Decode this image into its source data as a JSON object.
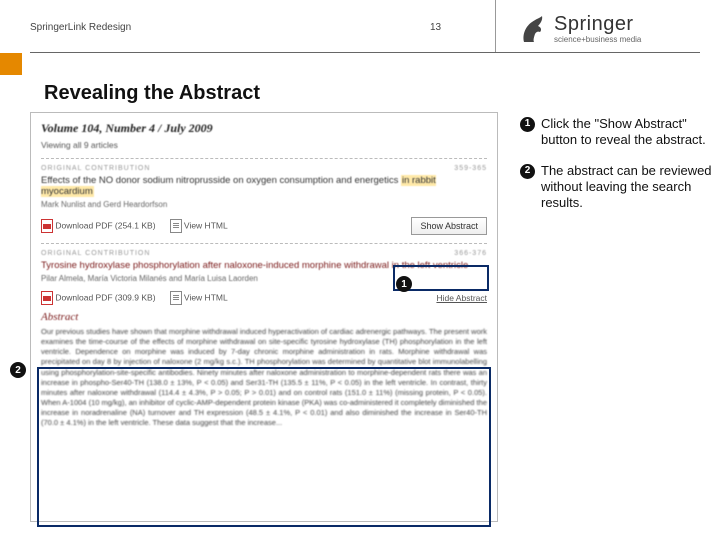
{
  "header": {
    "left": "SpringerLink Redesign",
    "page_number": "13",
    "logo_name": "Springer",
    "logo_tagline": "science+business media"
  },
  "title": "Revealing the Abstract",
  "notes": [
    {
      "num": "1",
      "text": "Click the \"Show Abstract\" button to reveal the abstract."
    },
    {
      "num": "2",
      "text": "The abstract can be reviewed without leaving the search results."
    }
  ],
  "markers": {
    "m1": "1",
    "m2": "2"
  },
  "figure": {
    "volume_line": "Volume 104, Number 4 / July 2009",
    "viewing": "Viewing all 9 articles",
    "article1": {
      "category": "ORIGINAL CONTRIBUTION",
      "pages": "359-365",
      "title_pre": "Effects of the NO donor sodium nitroprusside on oxygen consumption and energetics ",
      "title_hl": "in rabbit myocardium",
      "authors": "Mark Nunlist and Gerd Heardorfson",
      "download": "Download PDF (254.1 KB)",
      "view_html": "View HTML",
      "show_abstract": "Show Abstract"
    },
    "article2": {
      "category": "ORIGINAL CONTRIBUTION",
      "pages": "366-376",
      "title_pre": "Tyrosine hydroxylase phosphorylation after naloxone-induced morphine withdrawal ",
      "title_hl": "in the left ventricle",
      "authors": "Pilar Almela, María Victoria Milanés and María Luisa Laorden",
      "download": "Download PDF (309.9 KB)",
      "view_html": "View HTML",
      "hide_abstract": "Hide Abstract",
      "abstract_heading": "Abstract",
      "abstract_body": "Our previous studies have shown that morphine withdrawal induced hyperactivation of cardiac adrenergic pathways. The present work examines the time-course of the effects of morphine withdrawal on site-specific tyrosine hydroxylase (TH) phosphorylation in the left ventricle. Dependence on morphine was induced by 7-day chronic morphine administration in rats. Morphine withdrawal was precipitated on day 8 by injection of naloxone (2 mg/kg s.c.). TH phosphorylation was determined by quantitative blot immunolabelling using phosphorylation-site-specific antibodies. Ninety minutes after naloxone administration to morphine-dependent rats there was an increase in phospho-Ser40-TH (138.0 ± 13%, P < 0.05) and Ser31-TH (135.5 ± 11%, P < 0.05) in the left ventricle. In contrast, thirty minutes after naloxone withdrawal (114.4 ± 4.3%, P > 0.05; P > 0.01) and on control rats (151.0 ± 11%) (missing protein, P < 0.05). When A-1004 (10 mg/kg), an inhibitor of cyclic-AMP-dependent protein kinase (PKA) was co-administered it completely diminished the increase in noradrenaline (NA) turnover and TH expression (48.5 ± 4.1%, P < 0.01) and also diminished the increase in Ser40-TH (70.0 ± 4.1%) in the left ventricle. These data suggest that the increase..."
    }
  }
}
